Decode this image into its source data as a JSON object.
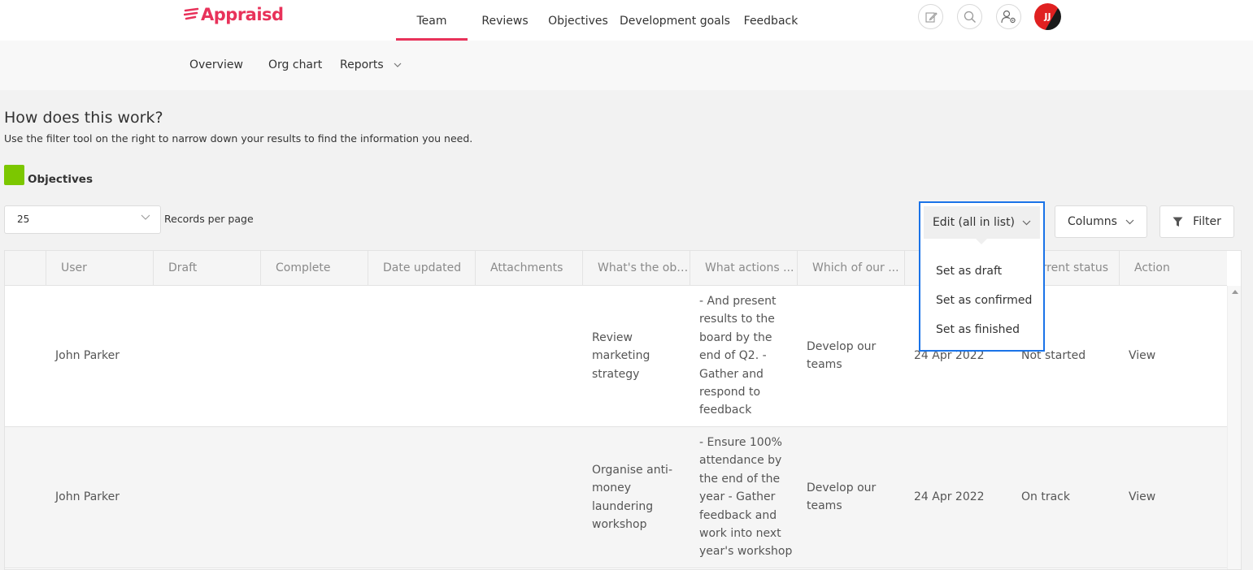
{
  "brand": {
    "name": "Appraisd",
    "color": "#e8325a"
  },
  "nav": {
    "items": [
      "Team",
      "Reviews",
      "Objectives",
      "Development goals",
      "Feedback"
    ],
    "active": "Team"
  },
  "header_icons": [
    "edit-icon",
    "search-icon",
    "user-settings-icon"
  ],
  "user": {
    "initials": "JJ"
  },
  "subnav": {
    "overview": "Overview",
    "org_chart": "Org chart",
    "reports": "Reports"
  },
  "intro": {
    "title": "How does this work?",
    "description": "Use the filter tool on the right to narrow down your results to find the information you need."
  },
  "legend": {
    "label": "Objectives",
    "color": "#7cc700"
  },
  "records": {
    "value": "25",
    "label": "Records per page"
  },
  "toolbar": {
    "edit_label": "Edit (all in list)",
    "columns_label": "Columns",
    "filter_label": "Filter",
    "edit_menu": [
      "Set as draft",
      "Set as confirmed",
      "Set as finished"
    ]
  },
  "table": {
    "headers": [
      "User",
      "Draft",
      "Complete",
      "Date updated",
      "Attachments",
      "What's the obj...",
      "What actions ...",
      "Which of our ...",
      "",
      "Current status",
      "Action"
    ],
    "rows": [
      {
        "user": "John Parker",
        "objective": "Review marketing strategy",
        "actions": "- And present results to the board by the end of Q2. - Gather and respond to feedback",
        "which": "Develop our teams",
        "date": "24 Apr 2022",
        "status": "Not started",
        "action": "View"
      },
      {
        "user": "John Parker",
        "objective": "Organise anti-money laundering workshop",
        "actions": "- Ensure 100% attendance by the end of the year - Gather feedback and work into next year's workshop",
        "which": "Develop our teams",
        "date": "24 Apr 2022",
        "status": "On track",
        "action": "View"
      }
    ]
  }
}
